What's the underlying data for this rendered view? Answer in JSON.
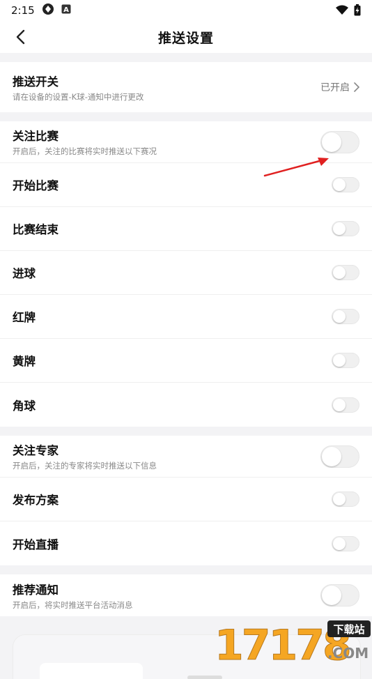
{
  "status_bar": {
    "time": "2:15",
    "icons_left": [
      "shield-icon",
      "a-badge-icon"
    ],
    "icons_right": [
      "wifi-icon",
      "battery-charging-icon"
    ]
  },
  "header": {
    "title": "推送设置",
    "back_icon": "chevron-left-icon"
  },
  "push_switch": {
    "label": "推送开关",
    "sub": "请在设备的设置-K球-通知中进行更改",
    "value": "已开启"
  },
  "match_section": {
    "follow": {
      "label": "关注比赛",
      "sub": "开启后，关注的比赛将实时推送以下赛况",
      "on": false
    },
    "items": [
      {
        "label": "开始比赛",
        "on": false
      },
      {
        "label": "比赛结束",
        "on": false
      },
      {
        "label": "进球",
        "on": false
      },
      {
        "label": "红牌",
        "on": false
      },
      {
        "label": "黄牌",
        "on": false
      },
      {
        "label": "角球",
        "on": false
      }
    ]
  },
  "expert_section": {
    "follow": {
      "label": "关注专家",
      "sub": "开启后，关注的专家将实时推送以下信息",
      "on": false
    },
    "items": [
      {
        "label": "发布方案",
        "on": false
      },
      {
        "label": "开始直播",
        "on": false
      }
    ]
  },
  "recommend": {
    "label": "推荐通知",
    "sub": "开启后，将实时推送平台活动消息",
    "on": false
  },
  "watermark": {
    "digits": "17178",
    "tag": "下载站",
    "domain": ".COM"
  },
  "colors": {
    "annotation_arrow": "#e02020",
    "watermark_orange": "#f5a623",
    "section_gap": "#f3f3f5"
  }
}
